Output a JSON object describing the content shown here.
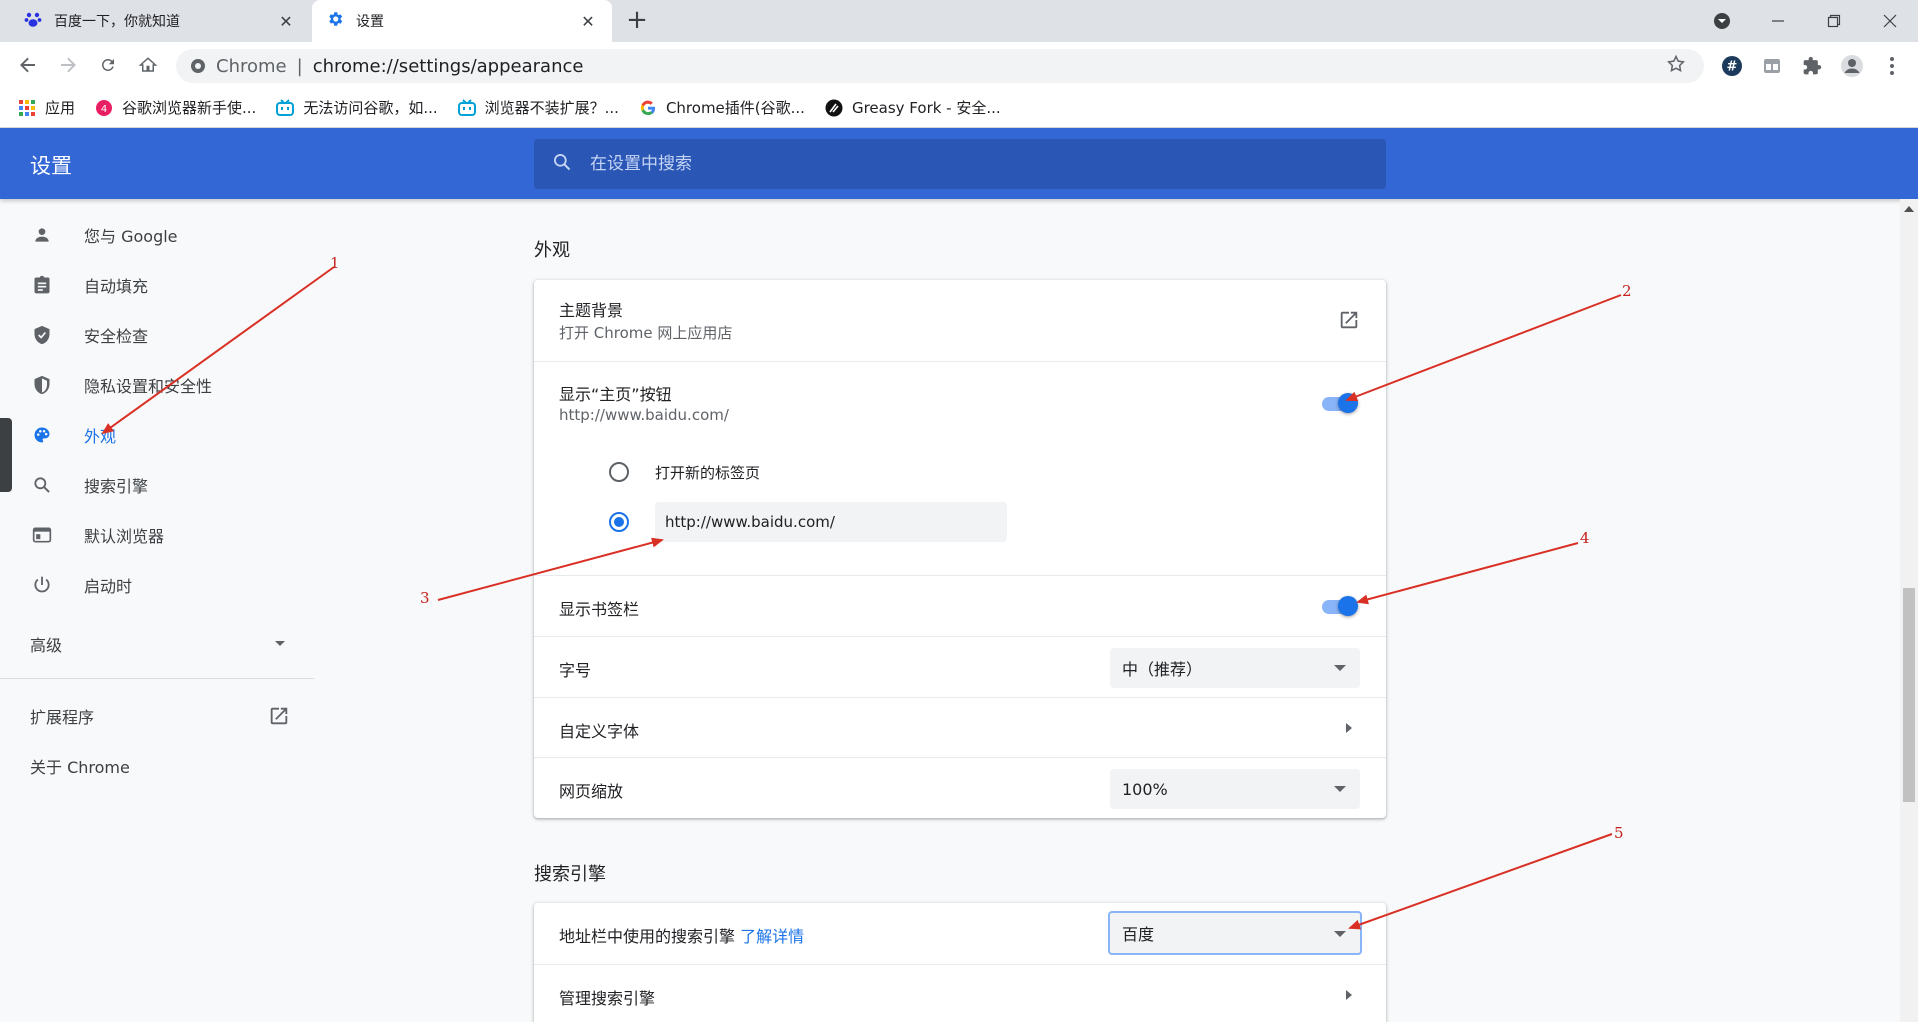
{
  "tabs": [
    {
      "title": "百度一下，你就知道",
      "icon": "baidu-paw-icon",
      "active": false
    },
    {
      "title": "设置",
      "icon": "settings-gear-icon",
      "active": true
    }
  ],
  "toolbar": {
    "url_scheme": "Chrome",
    "url_path": "chrome://settings/appearance"
  },
  "bookmarks": [
    {
      "label": "应用",
      "icon": "apps-grid-icon"
    },
    {
      "label": "谷歌浏览器新手使...",
      "icon": "pink-circle-icon"
    },
    {
      "label": "无法访问谷歌，如...",
      "icon": "bilibili-tv-icon"
    },
    {
      "label": "浏览器不装扩展？...",
      "icon": "bilibili-tv-icon"
    },
    {
      "label": "Chrome插件(谷歌...",
      "icon": "google-g-icon"
    },
    {
      "label": "Greasy Fork - 安全...",
      "icon": "greasyfork-icon"
    }
  ],
  "header": {
    "title": "设置",
    "search_placeholder": "在设置中搜索"
  },
  "sidebar": {
    "items": [
      {
        "label": "您与 Google",
        "icon": "person-icon"
      },
      {
        "label": "自动填充",
        "icon": "clipboard-icon"
      },
      {
        "label": "安全检查",
        "icon": "shield-check-icon"
      },
      {
        "label": "隐私设置和安全性",
        "icon": "shield-half-icon"
      },
      {
        "label": "外观",
        "icon": "palette-icon"
      },
      {
        "label": "搜索引擎",
        "icon": "search-icon"
      },
      {
        "label": "默认浏览器",
        "icon": "browser-window-icon"
      },
      {
        "label": "启动时",
        "icon": "power-icon"
      }
    ],
    "advanced_label": "高级",
    "extensions_label": "扩展程序",
    "about_label": "关于 Chrome"
  },
  "appearance": {
    "section_title": "外观",
    "theme_label": "主题背景",
    "theme_sub": "打开 Chrome 网上应用店",
    "home_button_label": "显示“主页”按钮",
    "home_button_sub": "http://www.baidu.com/",
    "radio_newtab_label": "打开新的标签页",
    "radio_custom_value": "http://www.baidu.com/",
    "bookmarks_bar_label": "显示书签栏",
    "font_size_label": "字号",
    "font_size_value": "中（推荐）",
    "custom_fonts_label": "自定义字体",
    "page_zoom_label": "网页缩放",
    "page_zoom_value": "100%"
  },
  "search_engine": {
    "section_title": "搜索引擎",
    "address_bar_label": "地址栏中使用的搜索引擎",
    "learn_more": "了解详情",
    "engine_value": "百度",
    "manage_label": "管理搜索引擎"
  },
  "annotations": {
    "n1": "1",
    "n2": "2",
    "n3": "3",
    "n4": "4",
    "n5": "5",
    "color": "#d93025"
  },
  "colors": {
    "header_blue": "#3367d6",
    "accent_blue": "#1a73e8"
  }
}
